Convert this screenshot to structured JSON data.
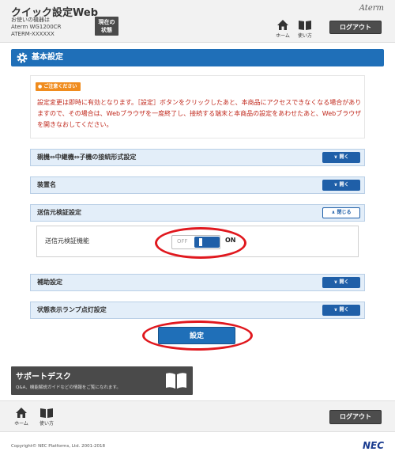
{
  "header": {
    "title": "クイック設定Web",
    "device_line1": "お使いの機器は",
    "device_line2": "Aterm WG1200CR",
    "device_line3": "ATERM-XXXXXX",
    "status_button_line1": "現在の",
    "status_button_line2": "状態",
    "brand": "Aterm",
    "home_label": "ホーム",
    "manual_label": "使い方",
    "logout_label": "ログアウト"
  },
  "section": {
    "title": "基本設定"
  },
  "notice": {
    "badge": "ご注意ください",
    "text": "設定変更は即時に有効となります。［設定］ボタンをクリックしたあと、本商品にアクセスできなくなる場合がありますので、その場合は、Webブラウザを一度終了し、接続する端末と本商品の設定をあわせたあと、Webブラウザを開きなおしてください。"
  },
  "accordions": [
    {
      "label": "親機⇔中継機⇔子機の接続形式設定",
      "button": "開く"
    },
    {
      "label": "装置名",
      "button": "開く"
    },
    {
      "label": "送信元検証設定",
      "button": "閉じる"
    },
    {
      "label": "補助設定",
      "button": "開く"
    },
    {
      "label": "状態表示ランプ点灯設定",
      "button": "開く"
    }
  ],
  "source_verification": {
    "label": "送信元検証機能",
    "off_label": "OFF",
    "on_label": "ON",
    "state": "ON"
  },
  "submit_label": "設定",
  "support": {
    "title": "サポートデスク",
    "description": "Q&A、機能解説ガイドなどの情報をご覧になれます。"
  },
  "footer": {
    "home_label": "ホーム",
    "manual_label": "使い方",
    "logout_label": "ログアウト",
    "copyright": "Copyright© NEC Platforms, Ltd. 2001-2018",
    "brand": "NEC"
  },
  "colors": {
    "primary": "#1f6fb8",
    "notice_text": "#c0281c",
    "highlight": "#e0181e"
  }
}
